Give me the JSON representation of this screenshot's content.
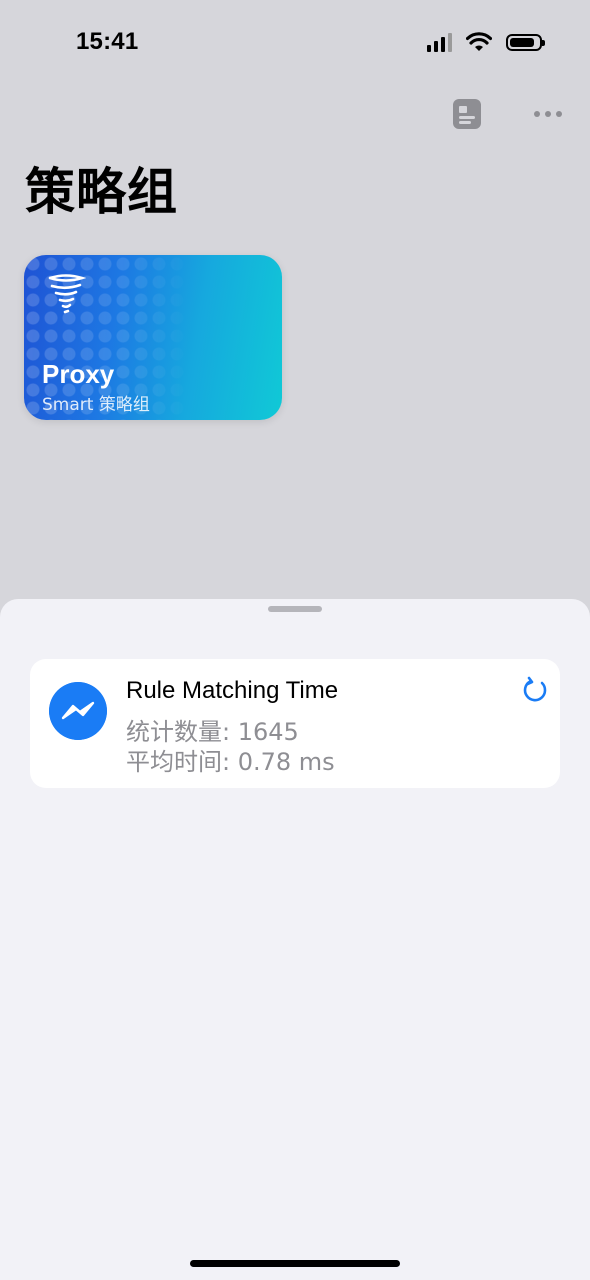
{
  "status_bar": {
    "time": "15:41"
  },
  "page": {
    "title": "策略组"
  },
  "proxy_card": {
    "name": "Proxy",
    "subtitle": "Smart 策略组",
    "gradient_start": "#1f52d4",
    "gradient_end": "#10c9d6"
  },
  "stats": {
    "title": "Rule Matching Time",
    "count_line": "统计数量: 1645",
    "avg_line": "平均时间: 0.78 ms",
    "accent": "#1a7cf5"
  },
  "icons": {
    "toolbar_left": "document-icon",
    "toolbar_right": "more-icon",
    "card": "tornado-icon",
    "stats": "messenger-icon",
    "refresh": "refresh-icon"
  }
}
